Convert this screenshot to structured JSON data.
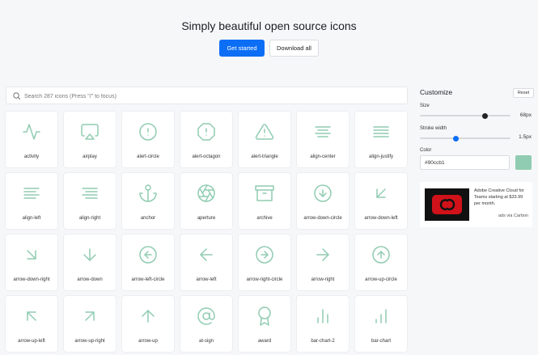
{
  "hero": {
    "title": "Simply beautiful open source icons",
    "primary_button": "Get started",
    "secondary_button": "Download all"
  },
  "search": {
    "placeholder": "Search 287 icons (Press \"/\" to focus)"
  },
  "icons": [
    {
      "name": "activity",
      "label": "activity"
    },
    {
      "name": "airplay",
      "label": "airplay"
    },
    {
      "name": "alert-circle",
      "label": "alert-circle"
    },
    {
      "name": "alert-octagon",
      "label": "alert-octagon"
    },
    {
      "name": "alert-triangle",
      "label": "alert-triangle"
    },
    {
      "name": "align-center",
      "label": "align-center"
    },
    {
      "name": "align-justify",
      "label": "align-justify"
    },
    {
      "name": "align-left",
      "label": "align-left"
    },
    {
      "name": "align-right",
      "label": "align-right"
    },
    {
      "name": "anchor",
      "label": "anchor"
    },
    {
      "name": "aperture",
      "label": "aperture"
    },
    {
      "name": "archive",
      "label": "archive"
    },
    {
      "name": "arrow-down-circle",
      "label": "arrow-down-circle"
    },
    {
      "name": "arrow-down-left",
      "label": "arrow-down-left"
    },
    {
      "name": "arrow-down-right",
      "label": "arrow-down-right"
    },
    {
      "name": "arrow-down",
      "label": "arrow-down"
    },
    {
      "name": "arrow-left-circle",
      "label": "arrow-left-circle"
    },
    {
      "name": "arrow-left",
      "label": "arrow-left"
    },
    {
      "name": "arrow-right-circle",
      "label": "arrow-right-circle"
    },
    {
      "name": "arrow-right",
      "label": "arrow-right"
    },
    {
      "name": "arrow-up-circle",
      "label": "arrow-up-circle"
    },
    {
      "name": "arrow-up-left",
      "label": "arrow-up-left"
    },
    {
      "name": "arrow-up-right",
      "label": "arrow-up-right"
    },
    {
      "name": "arrow-up",
      "label": "arrow-up"
    },
    {
      "name": "at-sign",
      "label": "at-sign"
    },
    {
      "name": "award",
      "label": "award"
    },
    {
      "name": "bar-chart-2",
      "label": "bar-chart-2"
    },
    {
      "name": "bar-chart",
      "label": "bar-chart"
    }
  ],
  "customize": {
    "title": "Customize",
    "reset": "Reset",
    "size_label": "Size",
    "size_value": "68px",
    "size_fraction": 0.72,
    "stroke_label": "Stroke width",
    "stroke_value": "1.5px",
    "stroke_fraction": 0.4,
    "color_label": "Color",
    "color_value": "#90ccb1"
  },
  "ad": {
    "text": "Adobe Creative Cloud for Teams starting at $33.99 per month.",
    "via": "ads via Carbon"
  },
  "colors": {
    "accent": "#0c6ef5",
    "icon": "#90ccb1",
    "size_thumb": "#222222",
    "stroke_thumb": "#0c6ef5"
  }
}
